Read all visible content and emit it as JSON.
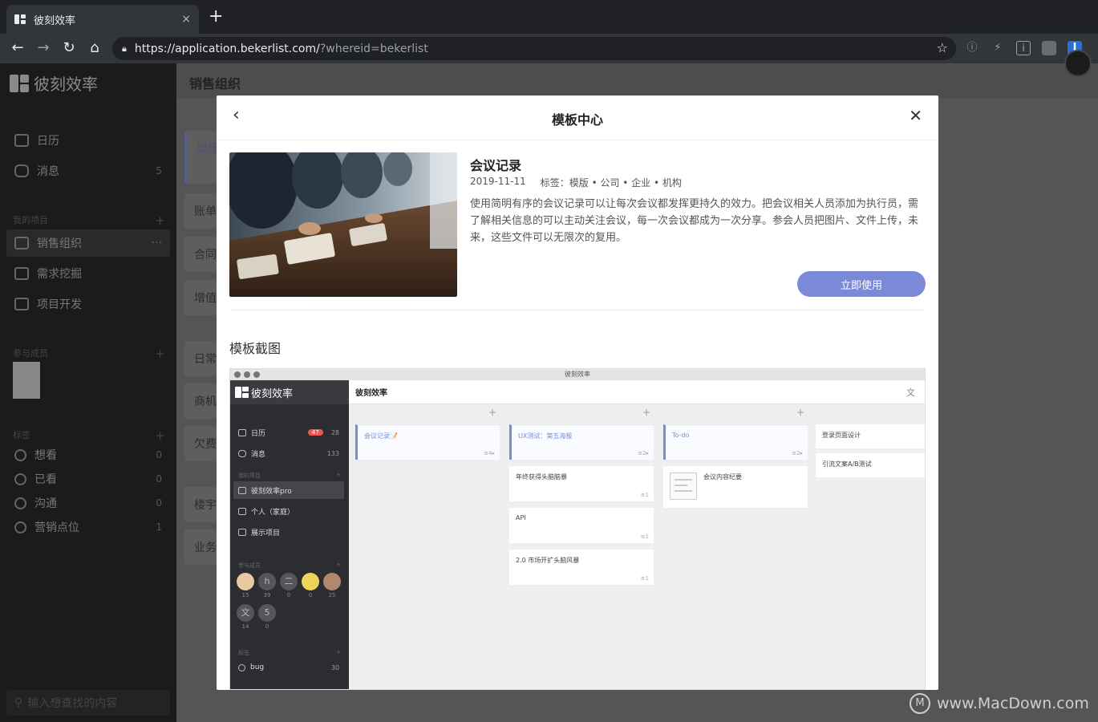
{
  "browser": {
    "tab_title": "彼刻效率",
    "tab_close": "×",
    "new_tab": "+",
    "url_host": "https://application.bekerlist.com/",
    "url_query": "?whereid=bekerlist"
  },
  "sidebar": {
    "brand": "彼刻效率",
    "nav": [
      {
        "label": "日历",
        "count": ""
      },
      {
        "label": "消息",
        "count": "5"
      }
    ],
    "projects_header": "我的项目",
    "projects": [
      {
        "label": "销售组织",
        "extra": "···"
      },
      {
        "label": "需求挖掘"
      },
      {
        "label": "项目开发"
      }
    ],
    "members_header": "参与成员",
    "tags_header": "标签",
    "tags": [
      {
        "label": "想看",
        "count": "0"
      },
      {
        "label": "已看",
        "count": "0"
      },
      {
        "label": "沟通",
        "count": "0"
      },
      {
        "label": "营销点位",
        "count": "1"
      }
    ],
    "search_placeholder": "输入想查找的内容",
    "add": "+"
  },
  "main": {
    "title": "销售组织",
    "bg_cards": [
      "现场",
      "账单",
      "合同",
      "增值",
      "日常",
      "商机",
      "欠费",
      "楼宇",
      "业务"
    ]
  },
  "modal": {
    "title": "模板中心",
    "template": {
      "name": "会议记录",
      "date": "2019-11-11",
      "tags": "标签：模版 • 公司 • 企业 • 机构",
      "description": "使用简明有序的会议记录可以让每次会议都发挥更持久的效力。把会议相关人员添加为执行员，需了解相关信息的可以主动关注会议，每一次会议都成为一次分享。参会人员把图片、文件上传，未来，这些文件可以无限次的复用。",
      "use_button": "立即使用"
    },
    "screenshot_section_title": "模板截图"
  },
  "preview": {
    "window_title": "彼刻效率",
    "brand": "彼刻效率",
    "header": "彼刻效率",
    "header_icon": "文",
    "nav": [
      {
        "label": "日历",
        "badge": "47",
        "count": "28"
      },
      {
        "label": "消息",
        "count": "133"
      }
    ],
    "projects_header": "我的项目",
    "projects": [
      "彼刻效率pro",
      "个人（家庭）",
      "展示项目"
    ],
    "members_header": "参与成员",
    "members": [
      {
        "label": "",
        "count": "15"
      },
      {
        "label": "h",
        "count": "39"
      },
      {
        "label": "二",
        "count": "0"
      },
      {
        "label": "",
        "count": "0"
      },
      {
        "label": "",
        "count": "25"
      },
      {
        "label": "文",
        "count": "14"
      },
      {
        "label": "5",
        "count": "0"
      }
    ],
    "tags_header": "标签",
    "tags": [
      {
        "label": "bug",
        "count": "30"
      }
    ],
    "columns": [
      {
        "cards": [
          {
            "title": "会议记录📝",
            "count": "≡4▸"
          }
        ]
      },
      {
        "cards": [
          {
            "title": "UX测试：第五海报",
            "count": "≡2▸"
          },
          {
            "title": "年终获得头脑脑暴",
            "count": "≡1"
          },
          {
            "title": "API",
            "count": "≡1"
          },
          {
            "title": "2.0 市场开扩头脑风暴",
            "count": "≡1"
          }
        ]
      },
      {
        "cards": [
          {
            "title": "To-do",
            "count": "≡2▸"
          },
          {
            "title": "会议内容纪要",
            "count": ""
          }
        ]
      },
      {
        "cards": [
          {
            "title": "登录页面设计"
          },
          {
            "title": "引流文案A/B测试"
          }
        ]
      }
    ],
    "add": "+"
  },
  "watermark": "www.MacDown.com",
  "colors": {
    "accent": "#7b8ad8",
    "sidebar": "#1b1b1b",
    "badge": "#e55555"
  }
}
